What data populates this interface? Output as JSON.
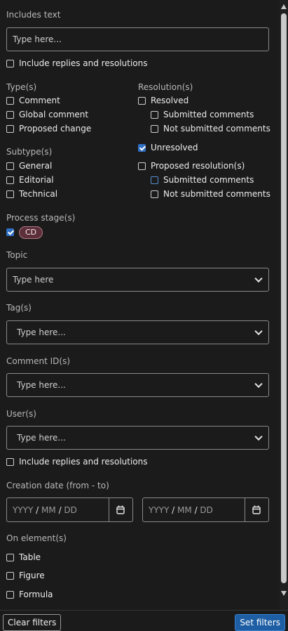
{
  "includes_text": {
    "label": "Includes text",
    "placeholder": "Type here...",
    "include_replies": "Include replies and resolutions"
  },
  "types": {
    "label": "Type(s)",
    "items": [
      "Comment",
      "Global comment",
      "Proposed change"
    ]
  },
  "resolutions": {
    "label": "Resolution(s)",
    "resolved": "Resolved",
    "submitted": "Submitted comments",
    "not_submitted": "Not submitted comments",
    "unresolved": "Unresolved",
    "proposed": "Proposed resolution(s)"
  },
  "subtypes": {
    "label": "Subtype(s)",
    "items": [
      "General",
      "Editorial",
      "Technical"
    ]
  },
  "process_stage": {
    "label": "Process stage(s)",
    "chip": "CD"
  },
  "topic": {
    "label": "Topic",
    "placeholder": "Type here"
  },
  "tags": {
    "label": "Tag(s)",
    "placeholder": "Type here..."
  },
  "comment_ids": {
    "label": "Comment ID(s)",
    "placeholder": "Type here..."
  },
  "users": {
    "label": "User(s)",
    "placeholder": "Type here...",
    "include_replies": "Include replies and resolutions"
  },
  "creation_date": {
    "label": "Creation date (from - to)",
    "from": {
      "y": "YYYY",
      "m": "MM",
      "d": "DD"
    },
    "to": {
      "y": "YYYY",
      "m": "MM",
      "d": "DD"
    }
  },
  "on_element": {
    "label": "On element(s)",
    "items": [
      "Table",
      "Figure",
      "Formula"
    ]
  },
  "footer": {
    "clear": "Clear filters",
    "set": "Set filters"
  },
  "colors": {
    "accent": "#2f6fc4",
    "chip_bg": "#5c2f3a",
    "button_primary": "#1d5ea4"
  }
}
